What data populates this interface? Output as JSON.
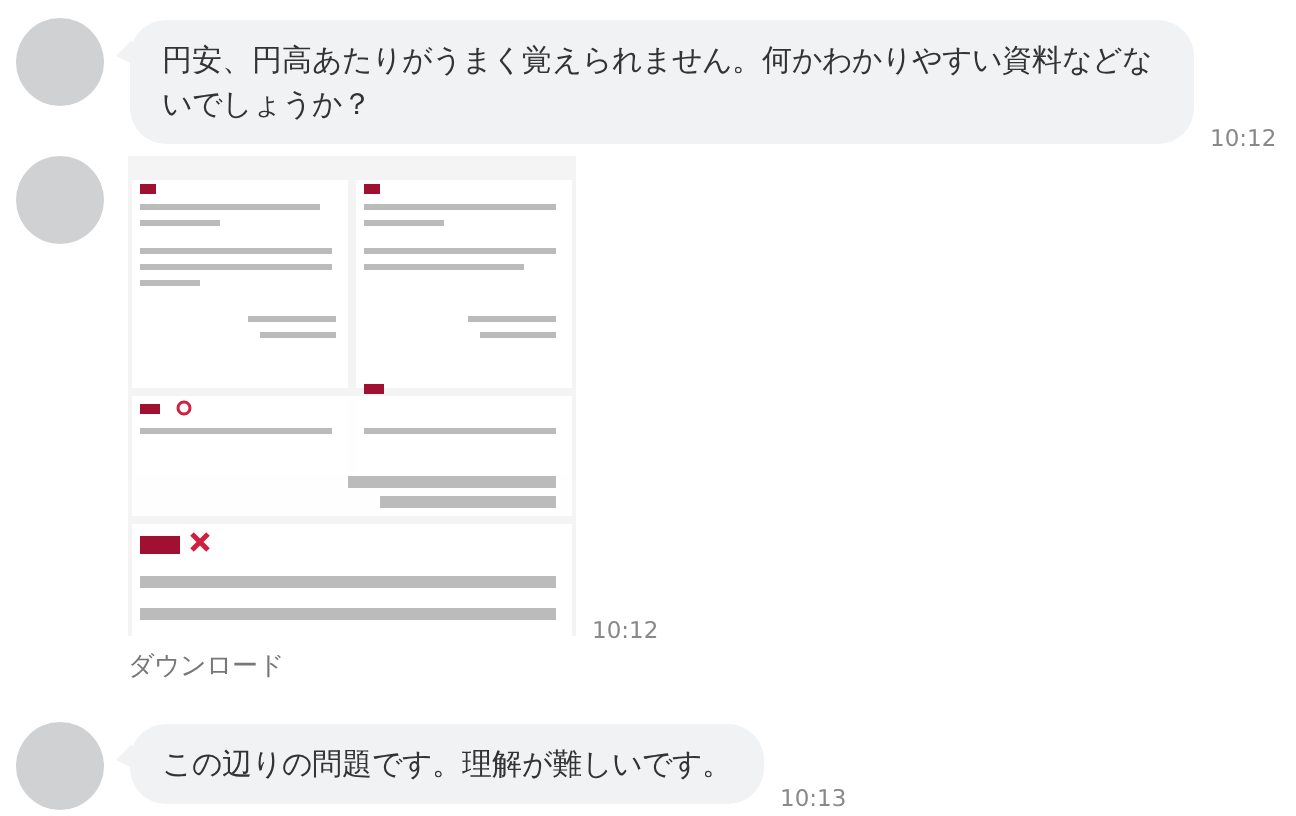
{
  "messages": [
    {
      "kind": "text",
      "text": "円安、円高あたりがうまく覚えられません。何かわかりやすい資料などないでしょうか？",
      "time": "10:12"
    },
    {
      "kind": "image",
      "time": "10:12",
      "action": "ダウンロード"
    },
    {
      "kind": "text",
      "text": "この辺りの問題です。理解が難しいです。",
      "time": "10:13"
    }
  ]
}
